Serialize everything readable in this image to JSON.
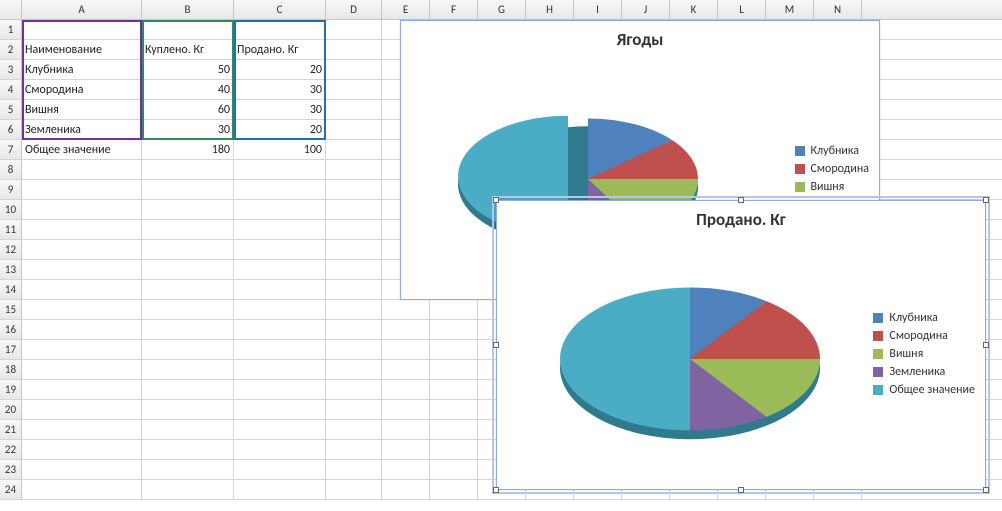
{
  "columns": [
    "A",
    "B",
    "C",
    "D",
    "E",
    "F",
    "G",
    "H",
    "I",
    "J",
    "K",
    "L",
    "M",
    "N"
  ],
  "rows": [
    1,
    2,
    3,
    4,
    5,
    6,
    7,
    8,
    9,
    10,
    11,
    12,
    13,
    14,
    15,
    16,
    17,
    18,
    19,
    20,
    21,
    22,
    23,
    24
  ],
  "table": {
    "headers": {
      "a": "Наименование",
      "b": "Куплено. Кг",
      "c": "Продано. Кг"
    },
    "data": [
      {
        "a": "Клубника",
        "b": 50,
        "c": 20
      },
      {
        "a": "Смородина",
        "b": 40,
        "c": 30
      },
      {
        "a": "Вишня",
        "b": 60,
        "c": 30
      },
      {
        "a": "Земленика",
        "b": 30,
        "c": 20
      },
      {
        "a": "Общее значение",
        "b": 180,
        "c": 100
      }
    ]
  },
  "legend_labels": [
    "Клубника",
    "Смородина",
    "Вишня",
    "Земленика",
    "Общее значение"
  ],
  "colors": {
    "c1": "#4f81bd",
    "c2": "#c0504d",
    "c3": "#9bbb59",
    "c4": "#8064a2",
    "c5": "#4bacc6"
  },
  "chart1": {
    "title": "Ягоды"
  },
  "chart2": {
    "title": "Продано. Кг"
  },
  "chart_data": [
    {
      "type": "pie",
      "title": "Ягоды",
      "categories": [
        "Клубника",
        "Смородина",
        "Вишня",
        "Земленика",
        "Общее значение"
      ],
      "values": [
        50,
        40,
        60,
        30,
        180
      ],
      "note": "3D pie, 'Общее значение' slice pulled out"
    },
    {
      "type": "pie",
      "title": "Продано. Кг",
      "categories": [
        "Клубника",
        "Смородина",
        "Вишня",
        "Земленика",
        "Общее значение"
      ],
      "values": [
        20,
        30,
        30,
        20,
        100
      ],
      "note": "3D pie"
    }
  ]
}
